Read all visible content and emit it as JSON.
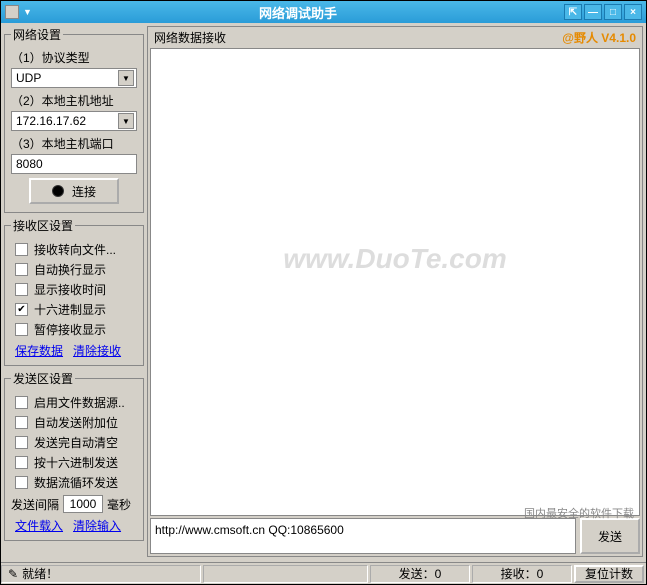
{
  "titlebar": {
    "title": "网络调试助手"
  },
  "network": {
    "legend": "网络设置",
    "protocol_label": "（1）协议类型",
    "protocol_value": "UDP",
    "host_label": "（2）本地主机地址",
    "host_value": "172.16.17.62",
    "port_label": "（3）本地主机端口",
    "port_value": "8080",
    "connect_label": "连接"
  },
  "recv_settings": {
    "legend": "接收区设置",
    "items": [
      {
        "label": "接收转向文件...",
        "checked": false
      },
      {
        "label": "自动换行显示",
        "checked": false
      },
      {
        "label": "显示接收时间",
        "checked": false
      },
      {
        "label": "十六进制显示",
        "checked": true
      },
      {
        "label": "暂停接收显示",
        "checked": false
      }
    ],
    "save_link": "保存数据",
    "clear_link": "清除接收"
  },
  "send_settings": {
    "legend": "发送区设置",
    "items": [
      {
        "label": "启用文件数据源..",
        "checked": false
      },
      {
        "label": "自动发送附加位",
        "checked": false
      },
      {
        "label": "发送完自动清空",
        "checked": false
      },
      {
        "label": "按十六进制发送",
        "checked": false
      },
      {
        "label": "数据流循环发送",
        "checked": false
      }
    ],
    "interval_label": "发送间隔",
    "interval_value": "1000",
    "interval_unit": "毫秒",
    "load_link": "文件载入",
    "clear_link": "清除输入"
  },
  "main": {
    "recv_legend": "网络数据接收",
    "version": "@野人 V4.1.0",
    "watermark": "www.DuoTe.com",
    "send_text": "http://www.cmsoft.cn QQ:10865600",
    "send_btn": "发送"
  },
  "status": {
    "ready": "就绪！",
    "send": "发送：0",
    "recv": "接收：0",
    "reset": "复位计数"
  },
  "brandmark": "国内最安全的软件下载"
}
